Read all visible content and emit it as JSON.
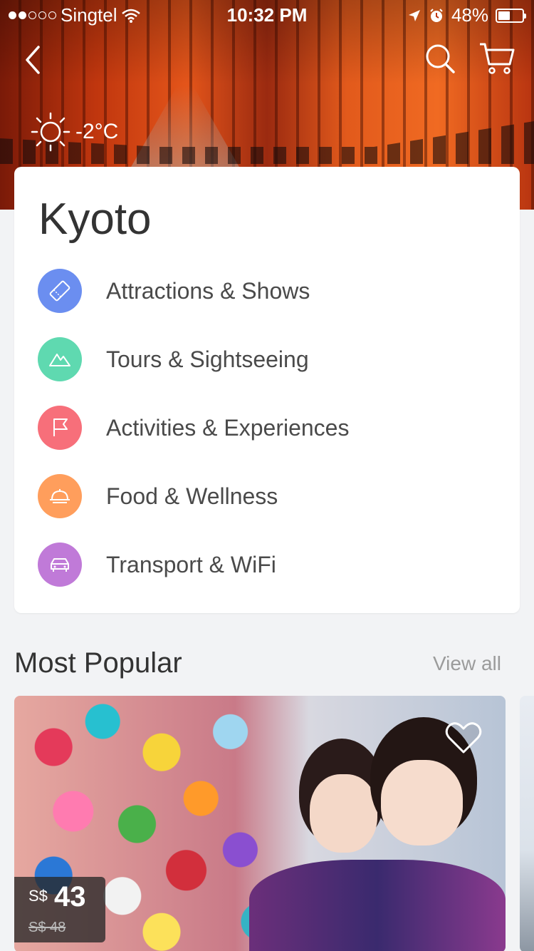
{
  "status_bar": {
    "carrier": "Singtel",
    "time": "10:32 PM",
    "battery": "48%"
  },
  "hero": {
    "temperature": "-2°C"
  },
  "city": {
    "name": "Kyoto"
  },
  "categories": [
    {
      "label": "Attractions & Shows",
      "color": "#6b8ef0",
      "icon": "ticket-icon"
    },
    {
      "label": "Tours & Sightseeing",
      "color": "#5fd9b0",
      "icon": "mountain-icon"
    },
    {
      "label": "Activities & Experiences",
      "color": "#f76f7a",
      "icon": "flag-icon"
    },
    {
      "label": "Food & Wellness",
      "color": "#ff9e5c",
      "icon": "cloche-icon"
    },
    {
      "label": "Transport & WiFi",
      "color": "#c07ad8",
      "icon": "car-icon"
    }
  ],
  "most_popular": {
    "title": "Most Popular",
    "view_all": "View all",
    "featured": {
      "currency": "S$",
      "price": "43",
      "original_price": "S$ 48"
    }
  }
}
